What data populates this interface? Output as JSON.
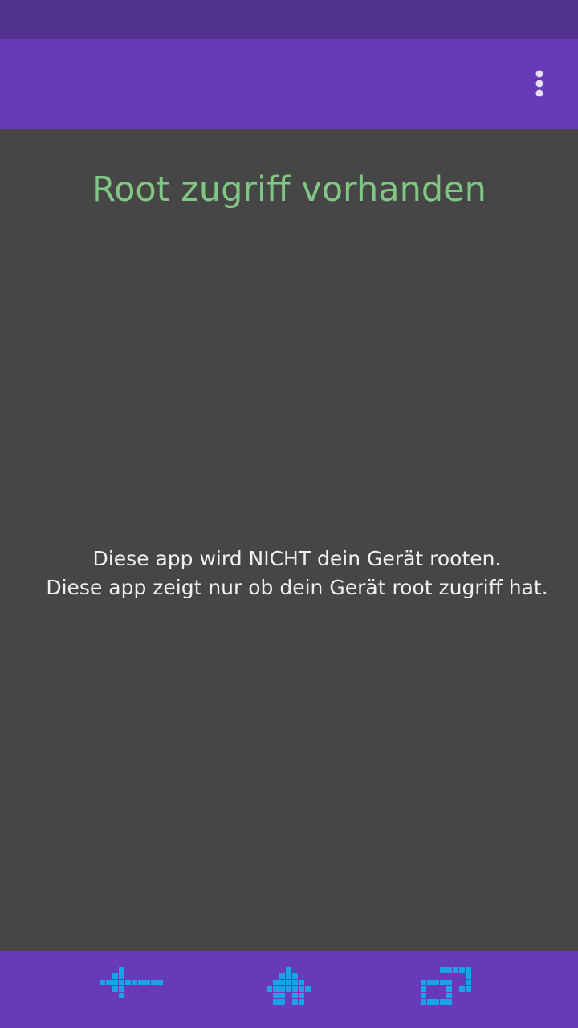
{
  "app": {
    "root_status": "Root zugriff vorhanden",
    "disclaimer_line1": "Diese app wird NICHT dein Gerät rooten.",
    "disclaimer_line2": "Diese app zeigt nur ob dein Gerät root zugriff hat."
  },
  "toolbar": {
    "overflow_icon": "more-vert-icon"
  },
  "navigation": {
    "back_icon": "pixel-arrow-back-icon",
    "home_icon": "pixel-arrow-up-icon",
    "recents_icon": "pixel-recents-icon"
  },
  "colors": {
    "status_bar": "#52328f",
    "app_bar": "#673ab7",
    "background": "#464646",
    "status_text": "#81c784",
    "nav_icon": "#1aa3e8"
  }
}
